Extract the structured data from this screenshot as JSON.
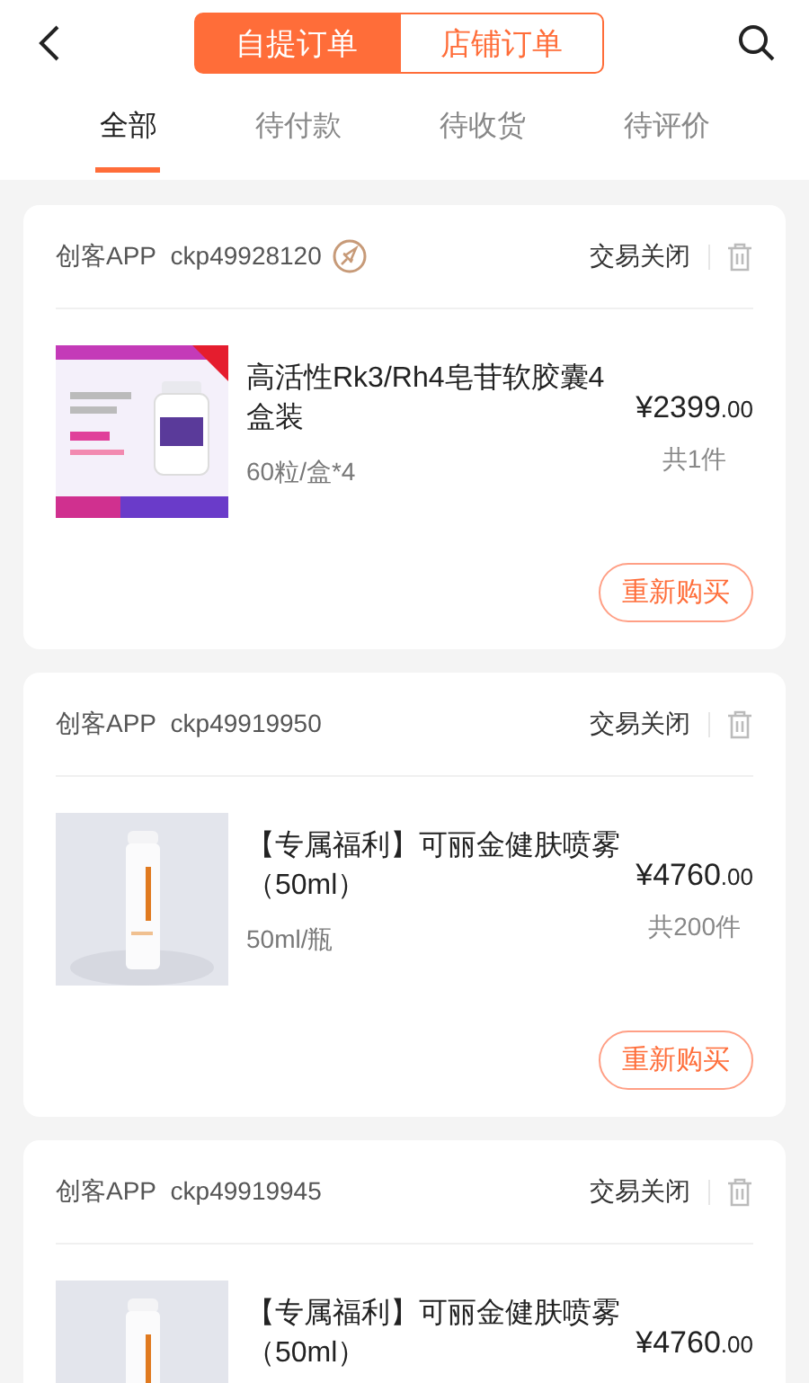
{
  "header": {
    "segments": [
      {
        "label": "自提订单",
        "selected": true
      },
      {
        "label": "店铺订单",
        "selected": false
      }
    ]
  },
  "tabs": [
    {
      "label": "全部",
      "selected": true
    },
    {
      "label": "待付款",
      "selected": false
    },
    {
      "label": "待收货",
      "selected": false
    },
    {
      "label": "待评价",
      "selected": false
    }
  ],
  "orders": [
    {
      "shop": "创客APP",
      "order_no": "ckp49928120",
      "rocket_badge": true,
      "status": "交易关闭",
      "product": {
        "kind": "picture",
        "title": "高活性Rk3/Rh4皂苷软胶囊4盒装",
        "spec": "60粒/盒*4",
        "price": "¥2399",
        "price_decimal": ".00",
        "count": "共1件"
      },
      "action": "重新购买"
    },
    {
      "shop": "创客APP",
      "order_no": "ckp49919950",
      "rocket_badge": false,
      "status": "交易关闭",
      "product": {
        "kind": "picture",
        "title": "【专属福利】可丽金健肤喷雾（50ml）",
        "spec": "50ml/瓶",
        "price": "¥4760",
        "price_decimal": ".00",
        "count": "共200件"
      },
      "action": "重新购买"
    },
    {
      "shop": "创客APP",
      "order_no": "ckp49919945",
      "rocket_badge": false,
      "status": "交易关闭",
      "product": {
        "kind": "picture",
        "title": "【专属福利】可丽金健肤喷雾（50ml）",
        "price": "¥4760",
        "price_decimal": ".00"
      }
    }
  ]
}
